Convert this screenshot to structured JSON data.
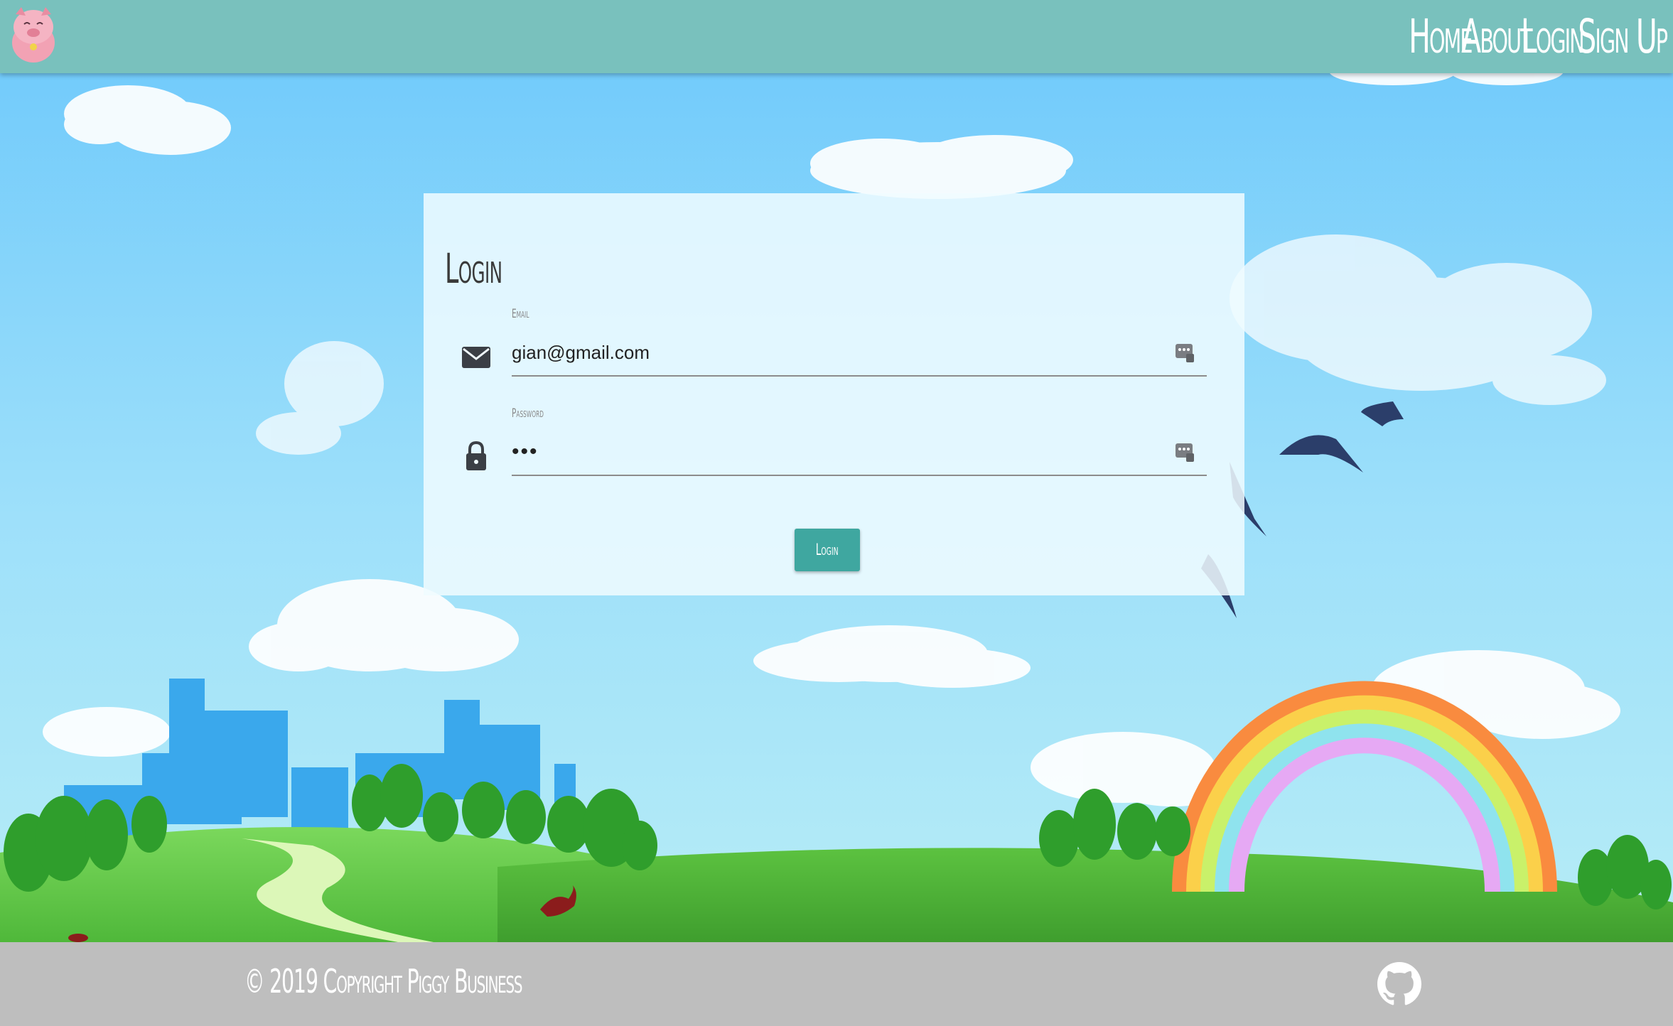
{
  "navbar": {
    "background": "#79c1bd",
    "logo": "pig-logo-icon",
    "links": [
      {
        "label": "Home"
      },
      {
        "label": "About"
      },
      {
        "label": "Login"
      },
      {
        "label": "Sign Up"
      }
    ]
  },
  "login_form": {
    "title": "Login",
    "email": {
      "label": "Email",
      "value": "gian@gmail.com",
      "icon": "envelope-icon"
    },
    "password": {
      "label": "Password",
      "value": "•••",
      "icon": "lock-icon"
    },
    "submit_label": "Login",
    "accent": "#3fa7a0"
  },
  "footer": {
    "copyright": "© 2019 Copyright Piggy Business",
    "github_icon": "github-icon",
    "background": "#bebebe"
  }
}
